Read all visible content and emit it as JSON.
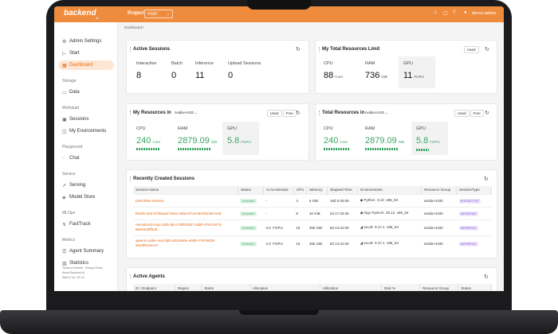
{
  "app": {
    "logo": "backend",
    "logo_sub": "AI",
    "project_label": "Project",
    "project_value": "H100",
    "user": "demo-admin"
  },
  "breadcrumb": "Dashboard  /",
  "sidebar": {
    "items": [
      {
        "label": "Admin Settings",
        "icon": "gear-icon"
      },
      {
        "label": "Start",
        "icon": "play-icon"
      },
      {
        "label": "Dashboard",
        "icon": "dashboard-icon"
      },
      {
        "label": "Data",
        "icon": "folder-icon"
      },
      {
        "label": "Sessions",
        "icon": "terminal-icon"
      },
      {
        "label": "My Environments",
        "icon": "box-icon"
      },
      {
        "label": "Chat",
        "icon": "chat-icon"
      },
      {
        "label": "Serving",
        "icon": "rocket-icon"
      },
      {
        "label": "Model Store",
        "icon": "store-icon"
      },
      {
        "label": "FastTrack",
        "icon": "flow-icon"
      },
      {
        "label": "Agent Summary",
        "icon": "agent-icon"
      },
      {
        "label": "Statistics",
        "icon": "chart-icon"
      }
    ],
    "groups": [
      "Storage",
      "Workload",
      "Playground",
      "Service",
      "MLOps",
      "Metrics"
    ],
    "footer": [
      "Terms of Service · Privacy Policy",
      "About Backend.AI",
      "WebUI ver. 25.4.0"
    ]
  },
  "active_sessions": {
    "title": "Active Sessions",
    "stats": [
      {
        "label": "Interactive",
        "value": "8"
      },
      {
        "label": "Batch",
        "value": "0"
      },
      {
        "label": "Inference",
        "value": "11"
      },
      {
        "label": "Upload Sessions",
        "value": "0"
      }
    ]
  },
  "total_limit": {
    "title": "My Total Resources Limit",
    "used_label": "Used",
    "cpu": {
      "label": "CPU",
      "value": "88",
      "unit": "Core"
    },
    "ram": {
      "label": "RAM",
      "value": "736",
      "unit": "GiB"
    },
    "gpu": {
      "label": "GPU",
      "value": "11",
      "unit": "FGPU"
    }
  },
  "my_resources": {
    "title": "My Resources in",
    "selector": "nvidia-H100",
    "used": "Used",
    "free": "Free",
    "cpu": {
      "label": "CPU",
      "value": "240",
      "unit": "Core"
    },
    "ram": {
      "label": "RAM",
      "value": "2879.09",
      "unit": "GiB"
    },
    "gpu": {
      "label": "GPU",
      "value": "5.8",
      "unit": "FGPU"
    }
  },
  "total_resources": {
    "title": "Total Resources in",
    "selector": "nvidia-H100",
    "used": "Used",
    "free": "Free",
    "cpu": {
      "label": "CPU",
      "value": "240",
      "unit": "Core"
    },
    "ram": {
      "label": "RAM",
      "value": "2879.09",
      "unit": "GiB"
    },
    "gpu": {
      "label": "GPU",
      "value": "5.8",
      "unit": "FGPU"
    }
  },
  "recent_sessions": {
    "title": "Recently Created Sessions",
    "columns": [
      "Session Name",
      "Status",
      "AI Accelerator",
      "CPU",
      "Memory",
      "Elapsed Time",
      "Environments",
      "Resource Group",
      "SessionType"
    ],
    "rows": [
      {
        "name": "pshOfeke-session",
        "status": "RUNNING",
        "accel": "-",
        "cpu": "4",
        "mem": "6 GiB",
        "elapsed": "19d 0:43:09",
        "env": "Python",
        "ver": "3.13",
        "arch": "x86_64",
        "group": "nvidia-H100",
        "type": "INTERACTIVE"
      },
      {
        "name": "bbafm-test-57262aef-0e94-4653-9716-86780c857c6d",
        "status": "RUNNING",
        "accel": "-",
        "cpu": "8",
        "mem": "16 GiB",
        "elapsed": "2d 17:43:30",
        "env": "Ngc Pytorch",
        "ver": "25.12",
        "arch": "x86_64",
        "group": "nvidia-H100",
        "type": "INFERENCE"
      },
      {
        "name": "nemotron3-nup-120b-fp4-2-9f0cb927-5d8f-47e5-b073-86eb3cbff536",
        "status": "RUNNING",
        "accel": "4.0",
        "accel_unit": "FGPU",
        "cpu": "16",
        "mem": "256 GiB",
        "elapsed": "6d 14:31:00",
        "env": "vLLM",
        "ver": "0.17.1",
        "arch": "x86_64",
        "group": "nvidia-H100",
        "type": "INFERENCE"
      },
      {
        "name": "qwen3-coder-next-fp8-a2510e5e-a589-47ef-9628-3e43f014ece7",
        "status": "RUNNING",
        "accel": "2.0",
        "accel_unit": "FGPU",
        "cpu": "16",
        "mem": "256 GiB",
        "elapsed": "6d 14:31:00",
        "env": "vLLM",
        "ver": "0.17.1",
        "arch": "x86_64",
        "group": "nvidia-H100",
        "type": "INFERENCE"
      }
    ]
  },
  "active_agents": {
    "title": "Active Agents",
    "columns": [
      "ID / Endpoint",
      "Region",
      "Starts",
      "Allocation",
      "Utilization",
      "Disk %",
      "Resource Group",
      "Status"
    ]
  }
}
